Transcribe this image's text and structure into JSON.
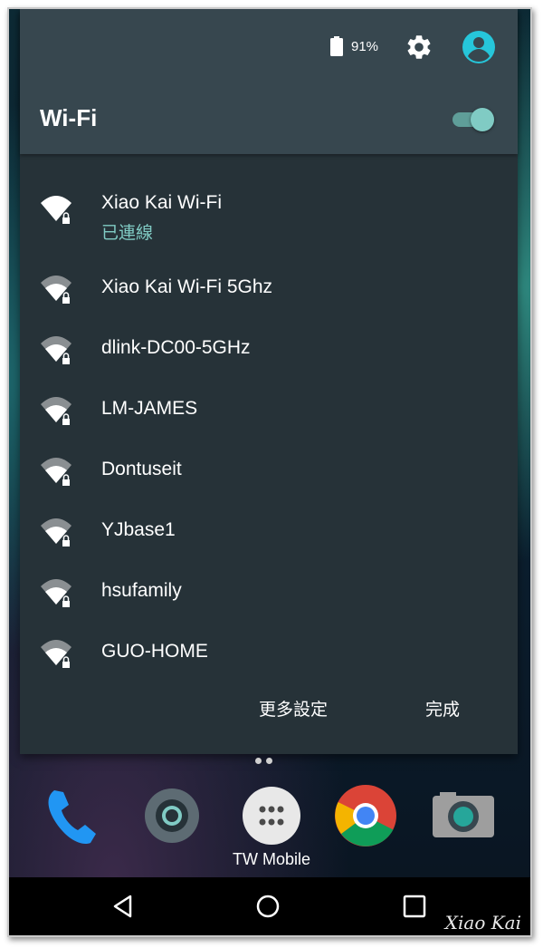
{
  "status": {
    "battery_percent": "91%"
  },
  "header": {
    "title": "Wi-Fi",
    "wifi_enabled": true
  },
  "networks": [
    {
      "name": "Xiao Kai Wi-Fi",
      "status": "已連線",
      "signal": "full"
    },
    {
      "name": "Xiao Kai Wi-Fi 5Ghz",
      "signal": "medium"
    },
    {
      "name": "dlink-DC00-5GHz",
      "signal": "medium"
    },
    {
      "name": "LM-JAMES",
      "signal": "medium"
    },
    {
      "name": "Dontuseit",
      "signal": "medium"
    },
    {
      "name": "YJbase1",
      "signal": "medium"
    },
    {
      "name": "hsufamily",
      "signal": "medium"
    },
    {
      "name": "GUO-HOME",
      "signal": "medium"
    }
  ],
  "actions": {
    "more_settings": "更多設定",
    "done": "完成"
  },
  "dock": {
    "folder_label": "TW Mobile",
    "icons": [
      "phone-icon",
      "settings-icon",
      "apps-icon",
      "chrome-icon",
      "camera-icon"
    ]
  },
  "watermark": "Xiao Kai",
  "colors": {
    "panel": "#263238",
    "header": "#37474f",
    "accent": "#80cbc4",
    "avatar": "#26c6da"
  }
}
